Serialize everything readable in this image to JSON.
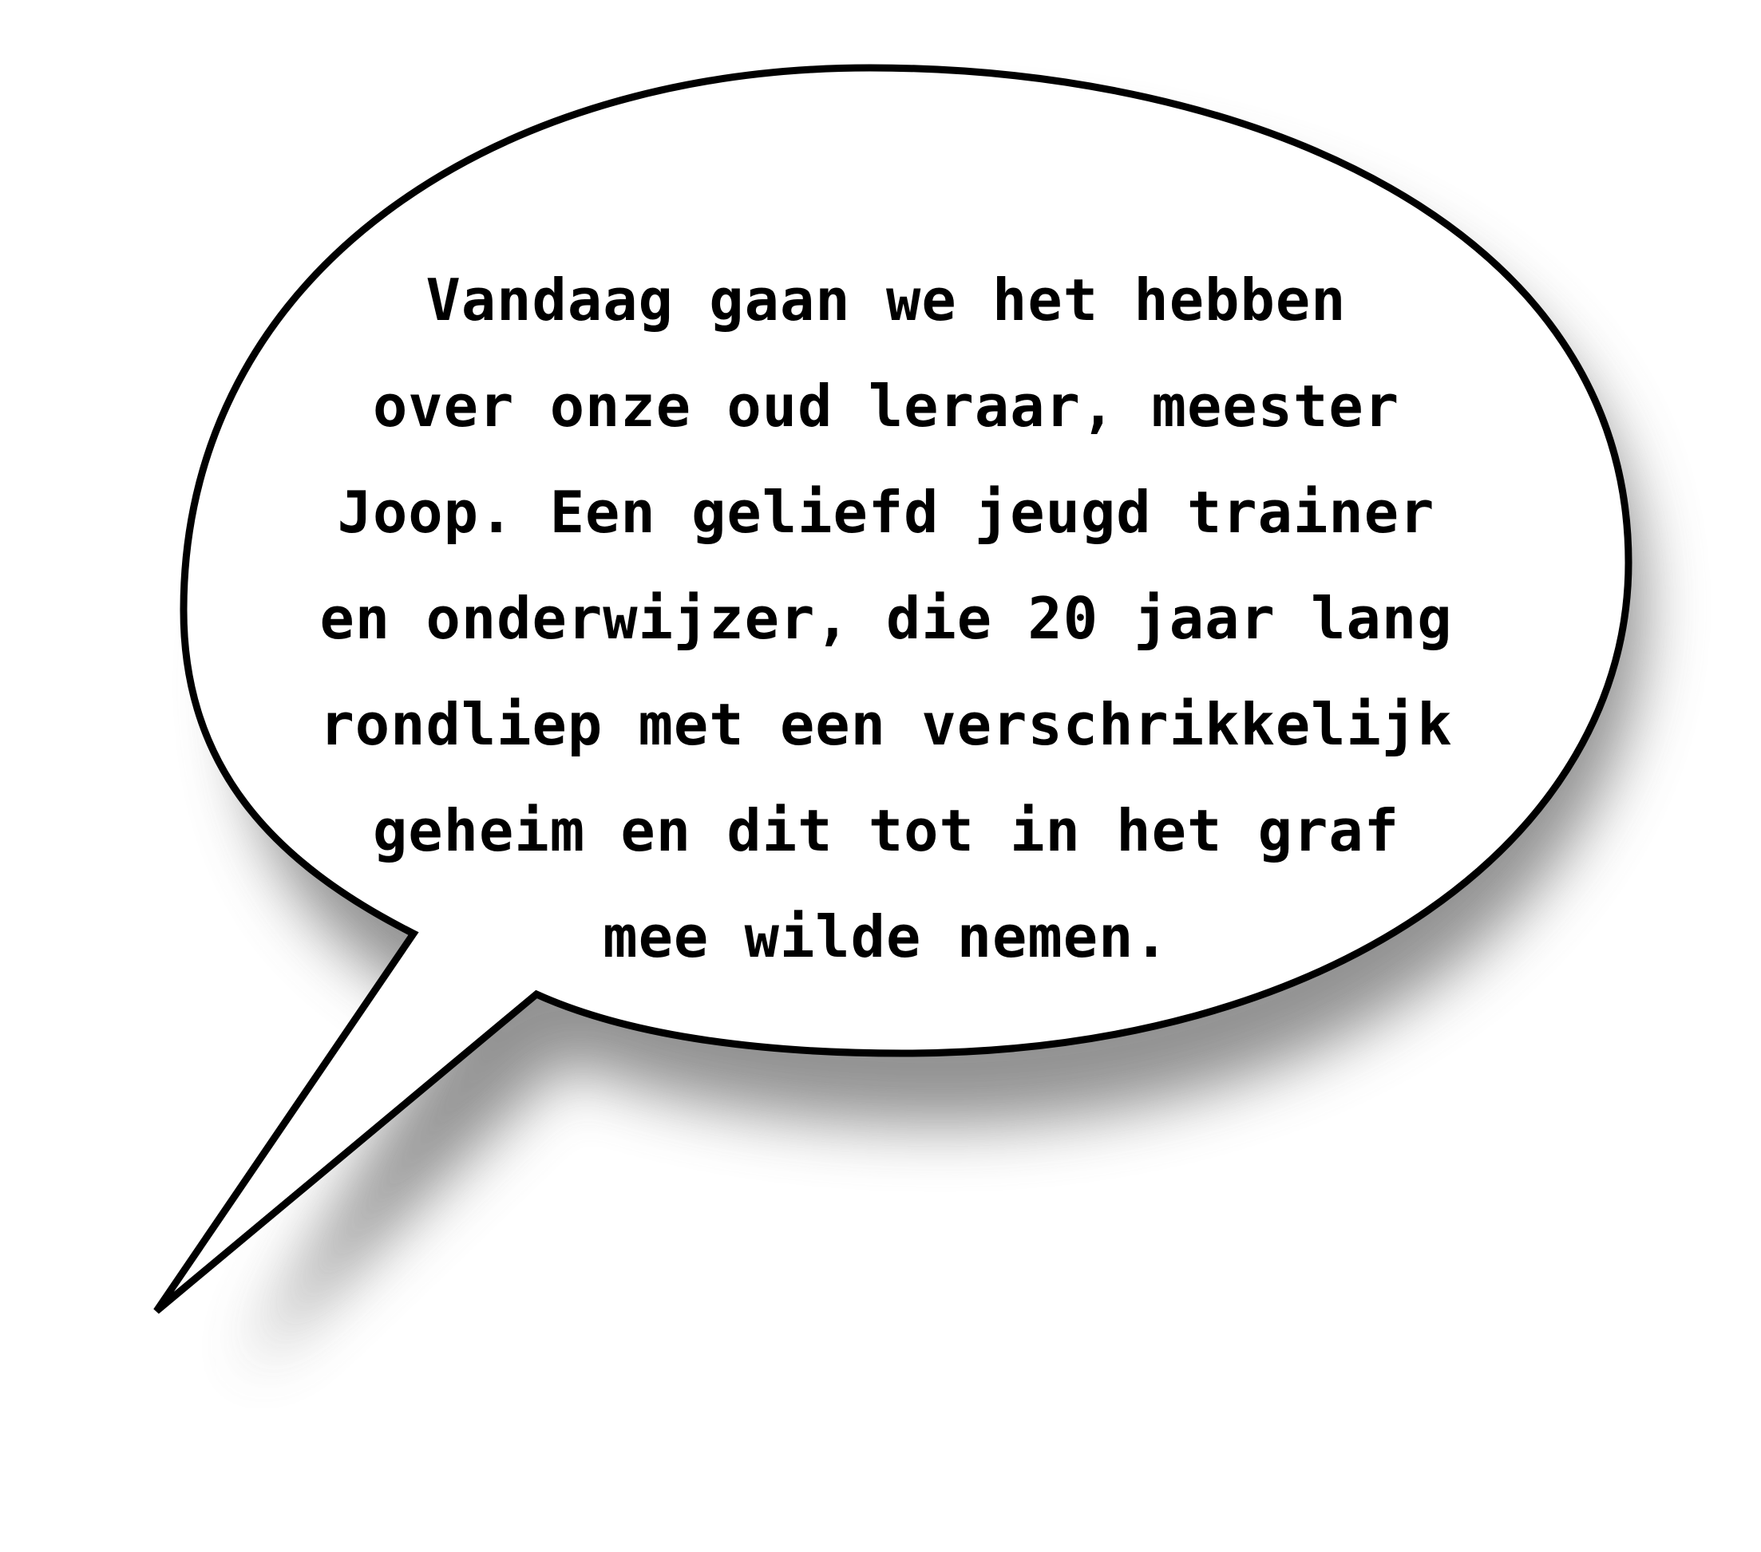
{
  "speech_bubble": {
    "lines": [
      "Vandaag gaan we het hebben",
      "over onze oud leraar, meester",
      "Joop. Een geliefd jeugd trainer",
      "en onderwijzer, die 20 jaar lang",
      "rondliep met een verschrikkelijk",
      "geheim en dit tot in het graf",
      "mee wilde nemen."
    ],
    "colors": {
      "fill": "#ffffff",
      "outline": "#000000",
      "shadow": "#7a7a7a",
      "text": "#000000"
    }
  }
}
